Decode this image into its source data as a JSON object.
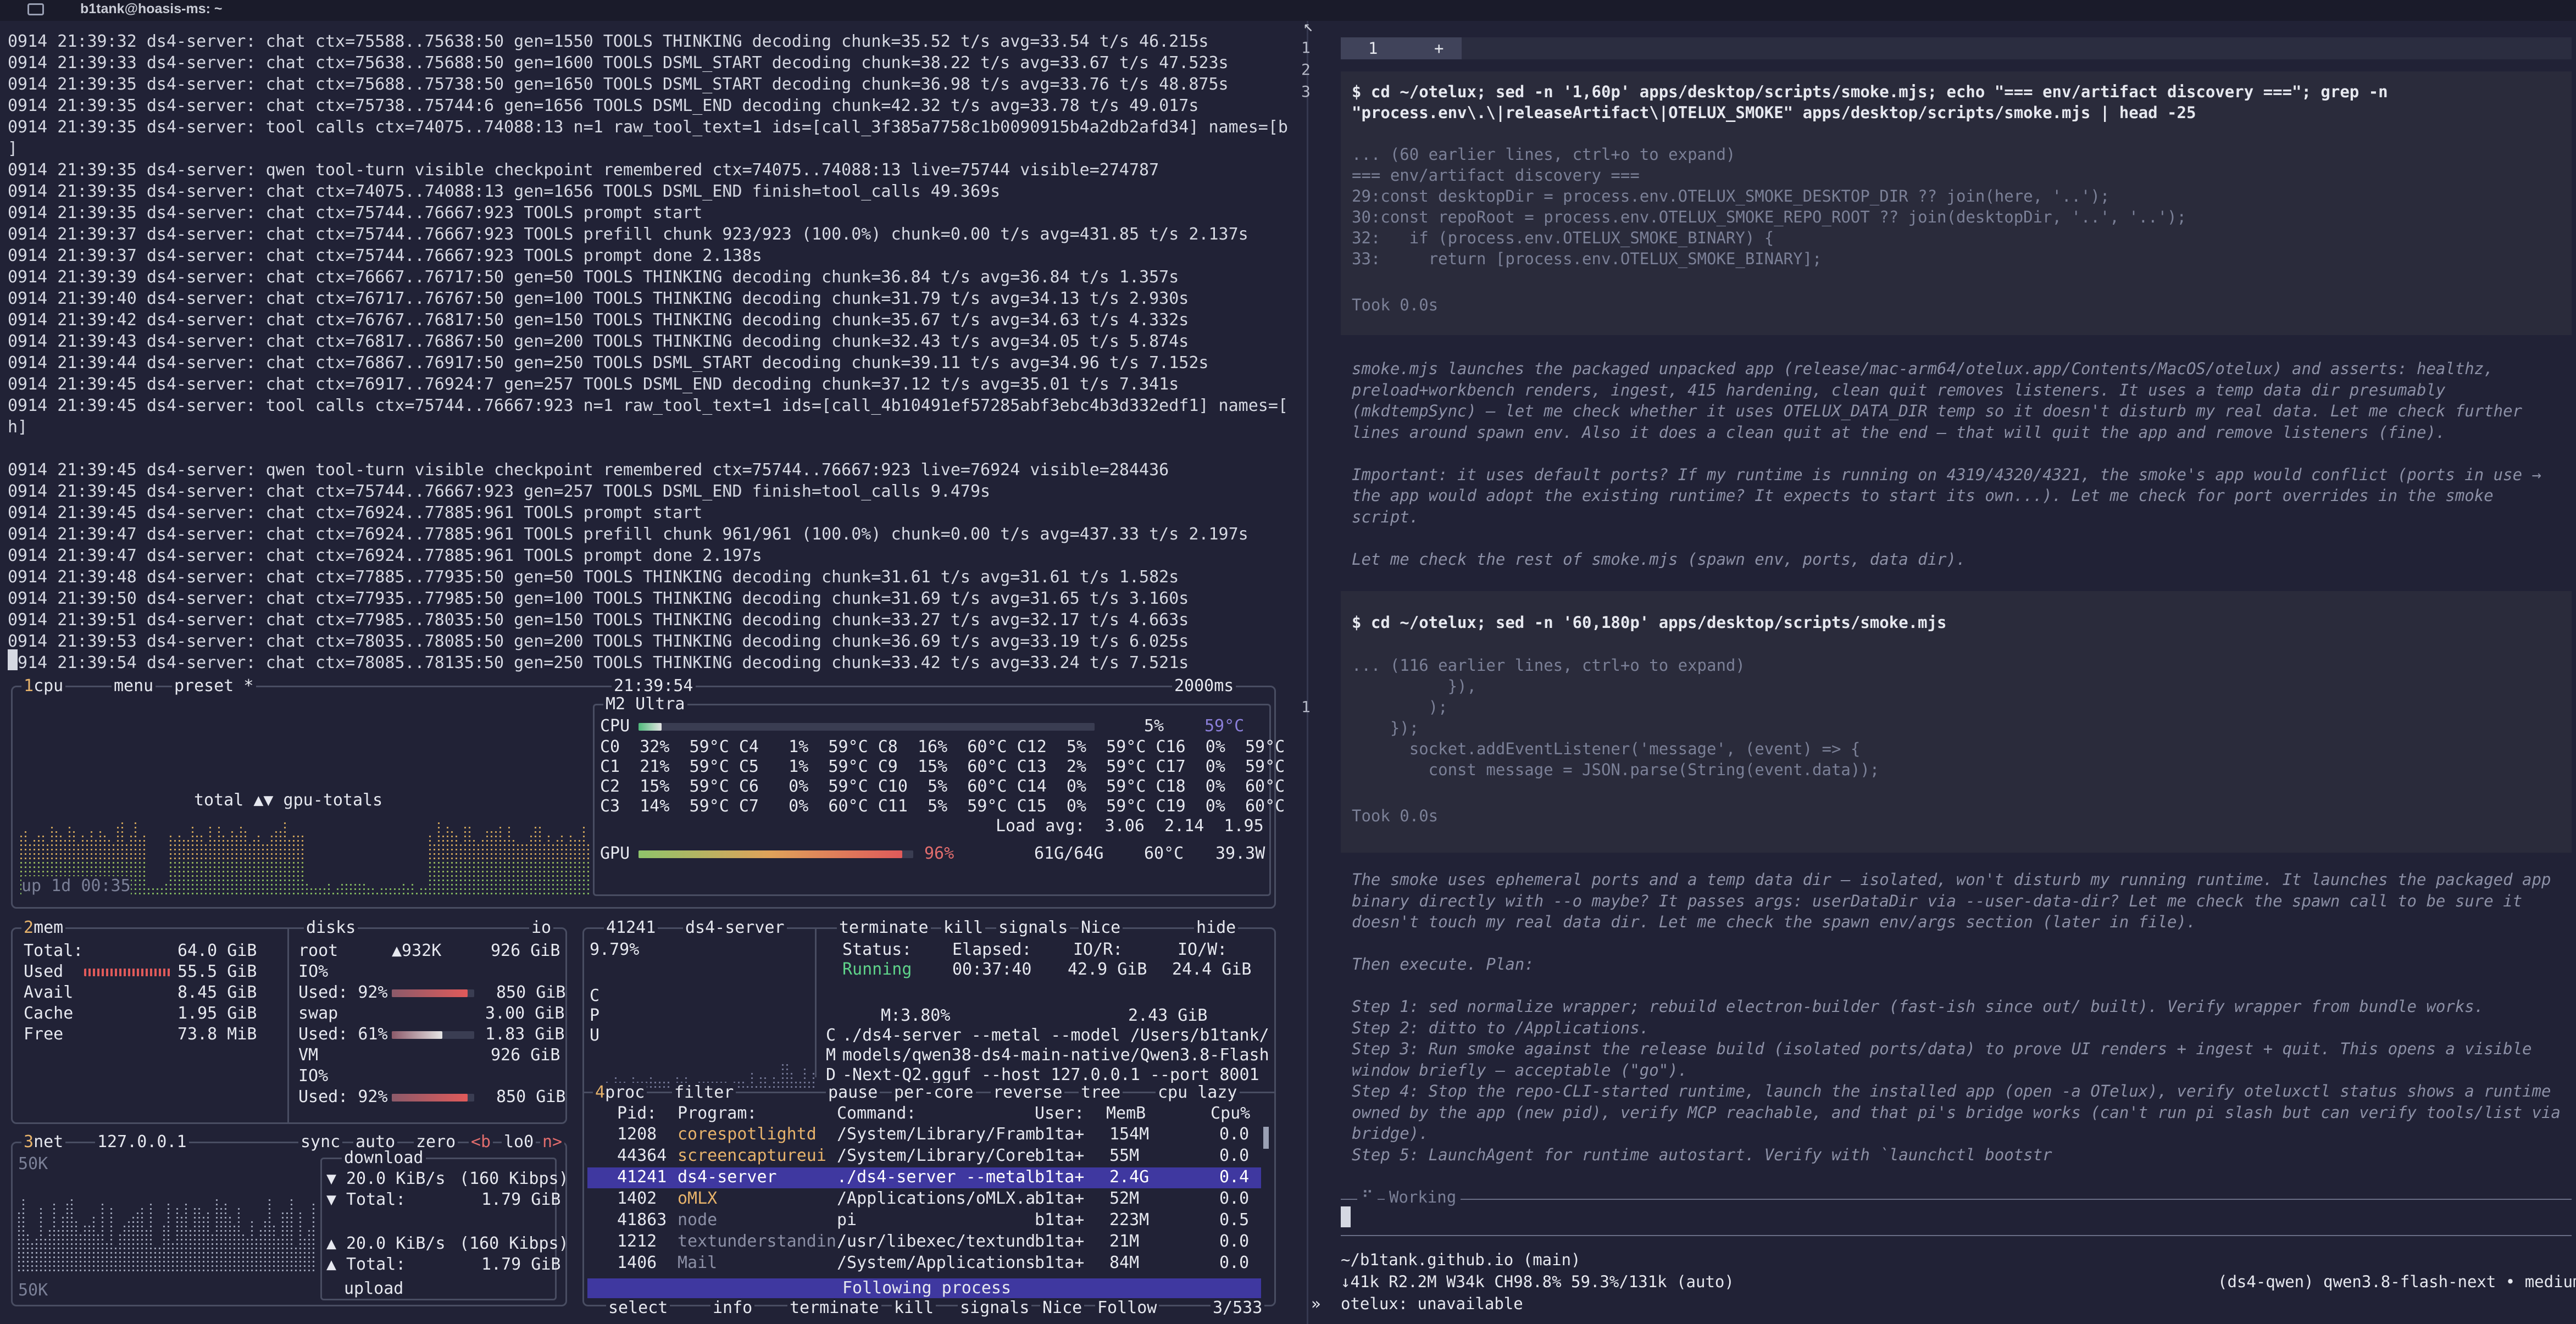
{
  "titlebar": {
    "title": "b1tank@hoasis-ms: ~"
  },
  "log_lines": [
    "0914 21:39:32 ds4-server: chat ctx=75588..75638:50 gen=1550 TOOLS THINKING decoding chunk=35.52 t/s avg=33.54 t/s 46.215s",
    "0914 21:39:33 ds4-server: chat ctx=75638..75688:50 gen=1600 TOOLS DSML_START decoding chunk=38.22 t/s avg=33.67 t/s 47.523s",
    "0914 21:39:35 ds4-server: chat ctx=75688..75738:50 gen=1650 TOOLS DSML_START decoding chunk=36.98 t/s avg=33.76 t/s 48.875s",
    "0914 21:39:35 ds4-server: chat ctx=75738..75744:6 gen=1656 TOOLS DSML_END decoding chunk=42.32 t/s avg=33.78 t/s 49.017s",
    "0914 21:39:35 ds4-server: tool calls ctx=74075..74088:13 n=1 raw_tool_text=1 ids=[call_3f385a7758c1b0090915b4a2db2afd34] names=[bash",
    "]",
    "0914 21:39:35 ds4-server: qwen tool-turn visible checkpoint remembered ctx=74075..74088:13 live=75744 visible=274787",
    "0914 21:39:35 ds4-server: chat ctx=74075..74088:13 gen=1656 TOOLS DSML_END finish=tool_calls 49.369s",
    "0914 21:39:35 ds4-server: chat ctx=75744..76667:923 TOOLS prompt start",
    "0914 21:39:37 ds4-server: chat ctx=75744..76667:923 TOOLS prefill chunk 923/923 (100.0%) chunk=0.00 t/s avg=431.85 t/s 2.137s",
    "0914 21:39:37 ds4-server: chat ctx=75744..76667:923 TOOLS prompt done 2.138s",
    "0914 21:39:39 ds4-server: chat ctx=76667..76717:50 gen=50 TOOLS THINKING decoding chunk=36.84 t/s avg=36.84 t/s 1.357s",
    "0914 21:39:40 ds4-server: chat ctx=76717..76767:50 gen=100 TOOLS THINKING decoding chunk=31.79 t/s avg=34.13 t/s 2.930s",
    "0914 21:39:42 ds4-server: chat ctx=76767..76817:50 gen=150 TOOLS THINKING decoding chunk=35.67 t/s avg=34.63 t/s 4.332s",
    "0914 21:39:43 ds4-server: chat ctx=76817..76867:50 gen=200 TOOLS THINKING decoding chunk=32.43 t/s avg=34.05 t/s 5.874s",
    "0914 21:39:44 ds4-server: chat ctx=76867..76917:50 gen=250 TOOLS DSML_START decoding chunk=39.11 t/s avg=34.96 t/s 7.152s",
    "0914 21:39:45 ds4-server: chat ctx=76917..76924:7 gen=257 TOOLS DSML_END decoding chunk=37.12 t/s avg=35.01 t/s 7.341s",
    "0914 21:39:45 ds4-server: tool calls ctx=75744..76667:923 n=1 raw_tool_text=1 ids=[call_4b10491ef57285abf3ebc4b3d332edf1] names=[bas",
    "h]",
    "",
    "0914 21:39:45 ds4-server: qwen tool-turn visible checkpoint remembered ctx=75744..76667:923 live=76924 visible=284436",
    "0914 21:39:45 ds4-server: chat ctx=75744..76667:923 gen=257 TOOLS DSML_END finish=tool_calls 9.479s",
    "0914 21:39:45 ds4-server: chat ctx=76924..77885:961 TOOLS prompt start",
    "0914 21:39:47 ds4-server: chat ctx=76924..77885:961 TOOLS prefill chunk 961/961 (100.0%) chunk=0.00 t/s avg=437.33 t/s 2.197s",
    "0914 21:39:47 ds4-server: chat ctx=76924..77885:961 TOOLS prompt done 2.197s",
    "0914 21:39:48 ds4-server: chat ctx=77885..77935:50 gen=50 TOOLS THINKING decoding chunk=31.61 t/s avg=31.61 t/s 1.582s",
    "0914 21:39:50 ds4-server: chat ctx=77935..77985:50 gen=100 TOOLS THINKING decoding chunk=31.69 t/s avg=31.65 t/s 3.160s",
    "0914 21:39:51 ds4-server: chat ctx=77985..78035:50 gen=150 TOOLS THINKING decoding chunk=33.27 t/s avg=32.17 t/s 4.663s",
    "0914 21:39:53 ds4-server: chat ctx=78035..78085:50 gen=200 TOOLS THINKING decoding chunk=36.69 t/s avg=33.19 t/s 6.025s",
    "0914 21:39:54 ds4-server: chat ctx=78085..78135:50 gen=250 TOOLS THINKING decoding chunk=33.42 t/s avg=33.24 t/s 7.521s"
  ],
  "btop": {
    "cpu_box": {
      "num": "1",
      "title": "cpu",
      "menu": "menu",
      "preset": "preset *",
      "clock": "21:39:54",
      "interval": "2000ms",
      "graph_label": "total ▲▼ gpu-totals",
      "uptime": "up 1d 00:35"
    },
    "cpu_info": {
      "model": "M2 Ultra",
      "cpu_label": "CPU",
      "cpu_pct": "5%",
      "cpu_temp": "59°C",
      "cpu_fill": 0.05,
      "cores": [
        "C0  32%  59°C C4   1%  59°C C8  16%  60°C C12  5%  59°C C16  0%  59°C",
        "C1  21%  59°C C5   1%  59°C C9  15%  60°C C13  2%  59°C C17  0%  59°C",
        "C2  15%  59°C C6   0%  59°C C10  5%  60°C C14  0%  59°C C18  0%  60°C",
        "C3  14%  59°C C7   0%  60°C C11  5%  59°C C15  0%  59°C C19  0%  60°C"
      ],
      "load_avg": "Load avg:  3.06  2.14  1.95",
      "gpu_label": "GPU",
      "gpu_pct": "96%",
      "gpu_mem": "61G/64G",
      "gpu_temp": "60°C",
      "gpu_power": "39.3W",
      "gpu_fill": 0.96
    },
    "mem_box": {
      "num": "2",
      "title": "mem",
      "disks_title": "disks",
      "io": "io",
      "rows": [
        {
          "label": "Total:",
          "value": "64.0 GiB"
        },
        {
          "label": "Used",
          "value": "55.5 GiB"
        },
        {
          "label": "Avail",
          "value": "8.45 GiB"
        },
        {
          "label": "Cache",
          "value": "1.95 GiB"
        },
        {
          "label": "Free",
          "value": "73.8 MiB"
        }
      ],
      "disks": [
        {
          "name": "root",
          "io": "▲932K",
          "size": "926 GiB",
          "io_label": "IO%",
          "used": "Used: 92%",
          "used_val": "850 GiB",
          "fill": 0.92
        },
        {
          "name": "swap",
          "io": "",
          "size": "3.00 GiB",
          "io_label": "",
          "used": "Used: 61%",
          "used_val": "1.83 GiB",
          "fill": 0.61
        },
        {
          "name": "VM",
          "io": "",
          "size": "926 GiB",
          "io_label": "IO%",
          "used": "Used: 92%",
          "used_val": "850 GiB",
          "fill": 0.92
        }
      ]
    },
    "net_box": {
      "num": "3",
      "title": "net",
      "iface": "127.0.0.1",
      "sync": "sync",
      "auto": "auto",
      "zero": "zero",
      "b": "<b",
      "lo0": "lo0",
      "n": "n>",
      "scale_top": "50K",
      "scale_bottom": "50K",
      "download_label": "download",
      "down_rate": "20.0 KiB/s",
      "down_kbps": "(160 Kibps)",
      "down_total_label": "Total:",
      "down_total": "1.79 GiB",
      "up_rate": "20.0 KiB/s",
      "up_kbps": "(160 Kibps)",
      "up_total_label": "Total:",
      "up_total": "1.79 GiB",
      "upload_label": "upload"
    },
    "proc_detail": {
      "pid": "41241",
      "name": "ds4-server",
      "terminate": "terminate",
      "kill": "kill",
      "signals": "signals",
      "nice": "Nice",
      "hide": "hide",
      "cpu_pct": "9.79%",
      "status_label": "Status:",
      "elapsed_label": "Elapsed:",
      "ior_label": "IO/R:",
      "iow_label": "IO/W:",
      "status": "Running",
      "elapsed": "00:37:40",
      "ior": "42.9 GiB",
      "iow": "24.4 GiB",
      "mem_pct": "M:3.80%",
      "mem_val": "2.43 GiB",
      "cmd": [
        "./ds4-server --metal --model /Users/b1tank/",
        "models/qwen38-ds4-main-native/Qwen3.8-Flash",
        "-Next-Q2.gguf --host 127.0.0.1 --port 8001"
      ],
      "cpu_letters": [
        "C",
        "P",
        "U"
      ],
      "cmd_letters": [
        "C",
        "M",
        "D"
      ]
    },
    "proc_box": {
      "num": "4",
      "title": "proc",
      "filter": "filter",
      "pause": "pause",
      "per_core": "per-core",
      "reverse": "reverse",
      "tree": "tree",
      "sort": "cpu lazy",
      "headers": [
        "Pid:",
        "Program:",
        "Command:",
        "User:",
        "MemB",
        "Cpu%"
      ],
      "rows": [
        {
          "pid": "1208",
          "prog": "corespotlightd",
          "cmd": "/System/Library/Fram",
          "user": "b1ta+",
          "mem": "154M",
          "cpu": "0.0"
        },
        {
          "pid": "44364",
          "prog": "screencaptureui",
          "cmd": "/System/Library/Core",
          "user": "b1ta+",
          "mem": "55M",
          "cpu": "0.0"
        },
        {
          "pid": "41241",
          "prog": "ds4-server",
          "cmd": "./ds4-server --metal",
          "user": "b1ta+",
          "mem": "2.4G",
          "cpu": "0.4"
        },
        {
          "pid": "1402",
          "prog": "oMLX",
          "cmd": "/Applications/oMLX.a",
          "user": "b1ta+",
          "mem": "52M",
          "cpu": "0.0"
        },
        {
          "pid": "41863",
          "prog": "node",
          "cmd": "pi",
          "user": "b1ta+",
          "mem": "223M",
          "cpu": "0.5"
        },
        {
          "pid": "1212",
          "prog": "textunderstandin",
          "cmd": "/usr/libexec/textund",
          "user": "b1ta+",
          "mem": "21M",
          "cpu": "0.0"
        },
        {
          "pid": "1406",
          "prog": "Mail",
          "cmd": "/System/Applications",
          "user": "b1ta+",
          "mem": "84M",
          "cpu": "0.0"
        }
      ],
      "following": "Following process",
      "footer": [
        "select",
        "info",
        "terminate",
        "kill",
        "signals",
        "Nice",
        "Follow"
      ],
      "count": "3/533"
    }
  },
  "right": {
    "tab_label": "1",
    "tab_plus": "+",
    "gutter": [
      "1",
      "2",
      "3"
    ],
    "gutter_mid": "1",
    "cmd1": "$ cd ~/otelux; sed -n '1,60p' apps/desktop/scripts/smoke.mjs; echo \"=== env/artifact discovery ===\"; grep -n",
    "cmd1b": "\"process.env\\.\\|releaseArtifact\\|OTELUX_SMOKE\" apps/desktop/scripts/smoke.mjs | head -25",
    "out1": [
      "... (60 earlier lines, ctrl+o to expand)",
      "=== env/artifact discovery ===",
      "29:const desktopDir = process.env.OTELUX_SMOKE_DESKTOP_DIR ?? join(here, '..');",
      "30:const repoRoot = process.env.OTELUX_SMOKE_REPO_ROOT ?? join(desktopDir, '..', '..');",
      "32:   if (process.env.OTELUX_SMOKE_BINARY) {",
      "33:     return [process.env.OTELUX_SMOKE_BINARY];"
    ],
    "took1": "Took 0.0s",
    "think1": [
      "smoke.mjs launches the packaged unpacked app (release/mac-arm64/otelux.app/Contents/MacOS/otelux) and asserts: healthz,",
      "preload+workbench renders, ingest, 415 hardening, clean quit removes listeners. It uses a temp data dir presumably",
      "(mkdtempSync) — let me check whether it uses OTELUX_DATA_DIR temp so it doesn't disturb my real data. Let me check further",
      "lines around spawn env. Also it does a clean quit at the end — that will quit the app and remove listeners (fine).",
      "",
      "Important: it uses default ports? If my runtime is running on 4319/4320/4321, the smoke's app would conflict (ports in use →",
      "the app would adopt the existing runtime? It expects to start its own...). Let me check for port overrides in the smoke",
      "script.",
      "",
      "Let me check the rest of smoke.mjs (spawn env, ports, data dir)."
    ],
    "cmd2": "$ cd ~/otelux; sed -n '60,180p' apps/desktop/scripts/smoke.mjs",
    "out2": [
      "... (116 earlier lines, ctrl+o to expand)",
      "          }),",
      "        );",
      "    });",
      "      socket.addEventListener('message', (event) => {",
      "        const message = JSON.parse(String(event.data));"
    ],
    "took2": "Took 0.0s",
    "think2": [
      "The smoke uses ephemeral ports and a temp data dir — isolated, won't disturb my running runtime. It launches the packaged app",
      "binary directly with --o maybe? It passes args: userDataDir via --user-data-dir? Let me check the spawn call to be sure it",
      "doesn't touch my real data dir. Let me check the spawn env/args section (later in file).",
      "",
      "Then execute. Plan:",
      "",
      "Step 1: sed normalize wrapper; rebuild electron-builder (fast-ish since out/ built). Verify wrapper from bundle works.",
      "Step 2: ditto to /Applications.",
      "Step 3: Run smoke against the release build (isolated ports/data) to prove UI renders + ingest + quit. This opens a visible",
      "window briefly — acceptable (\"go\").",
      "Step 4: Stop the repo-CLI-started runtime, launch the installed app (open -a OTelux), verify otelux​ctl status shows a runtime",
      "owned by the app (new pid), verify MCP reachable, and that pi's bridge works (can't run pi slash but can verify tools/list via",
      "bridge).",
      "Step 5: LaunchAgent for runtime autostart. Verify with `launchctl bootstr"
    ],
    "working": "Working",
    "status_path": "~/b1tank.github.io (main)",
    "status_stats": "↓41k R2.2M W34k CH98.8% 59.3%/131k (auto)",
    "status_model": "(ds4-qwen) qwen3.8-flash-next • medium",
    "prompt_sym": "»",
    "status_line3": "otelux: unavailable"
  }
}
